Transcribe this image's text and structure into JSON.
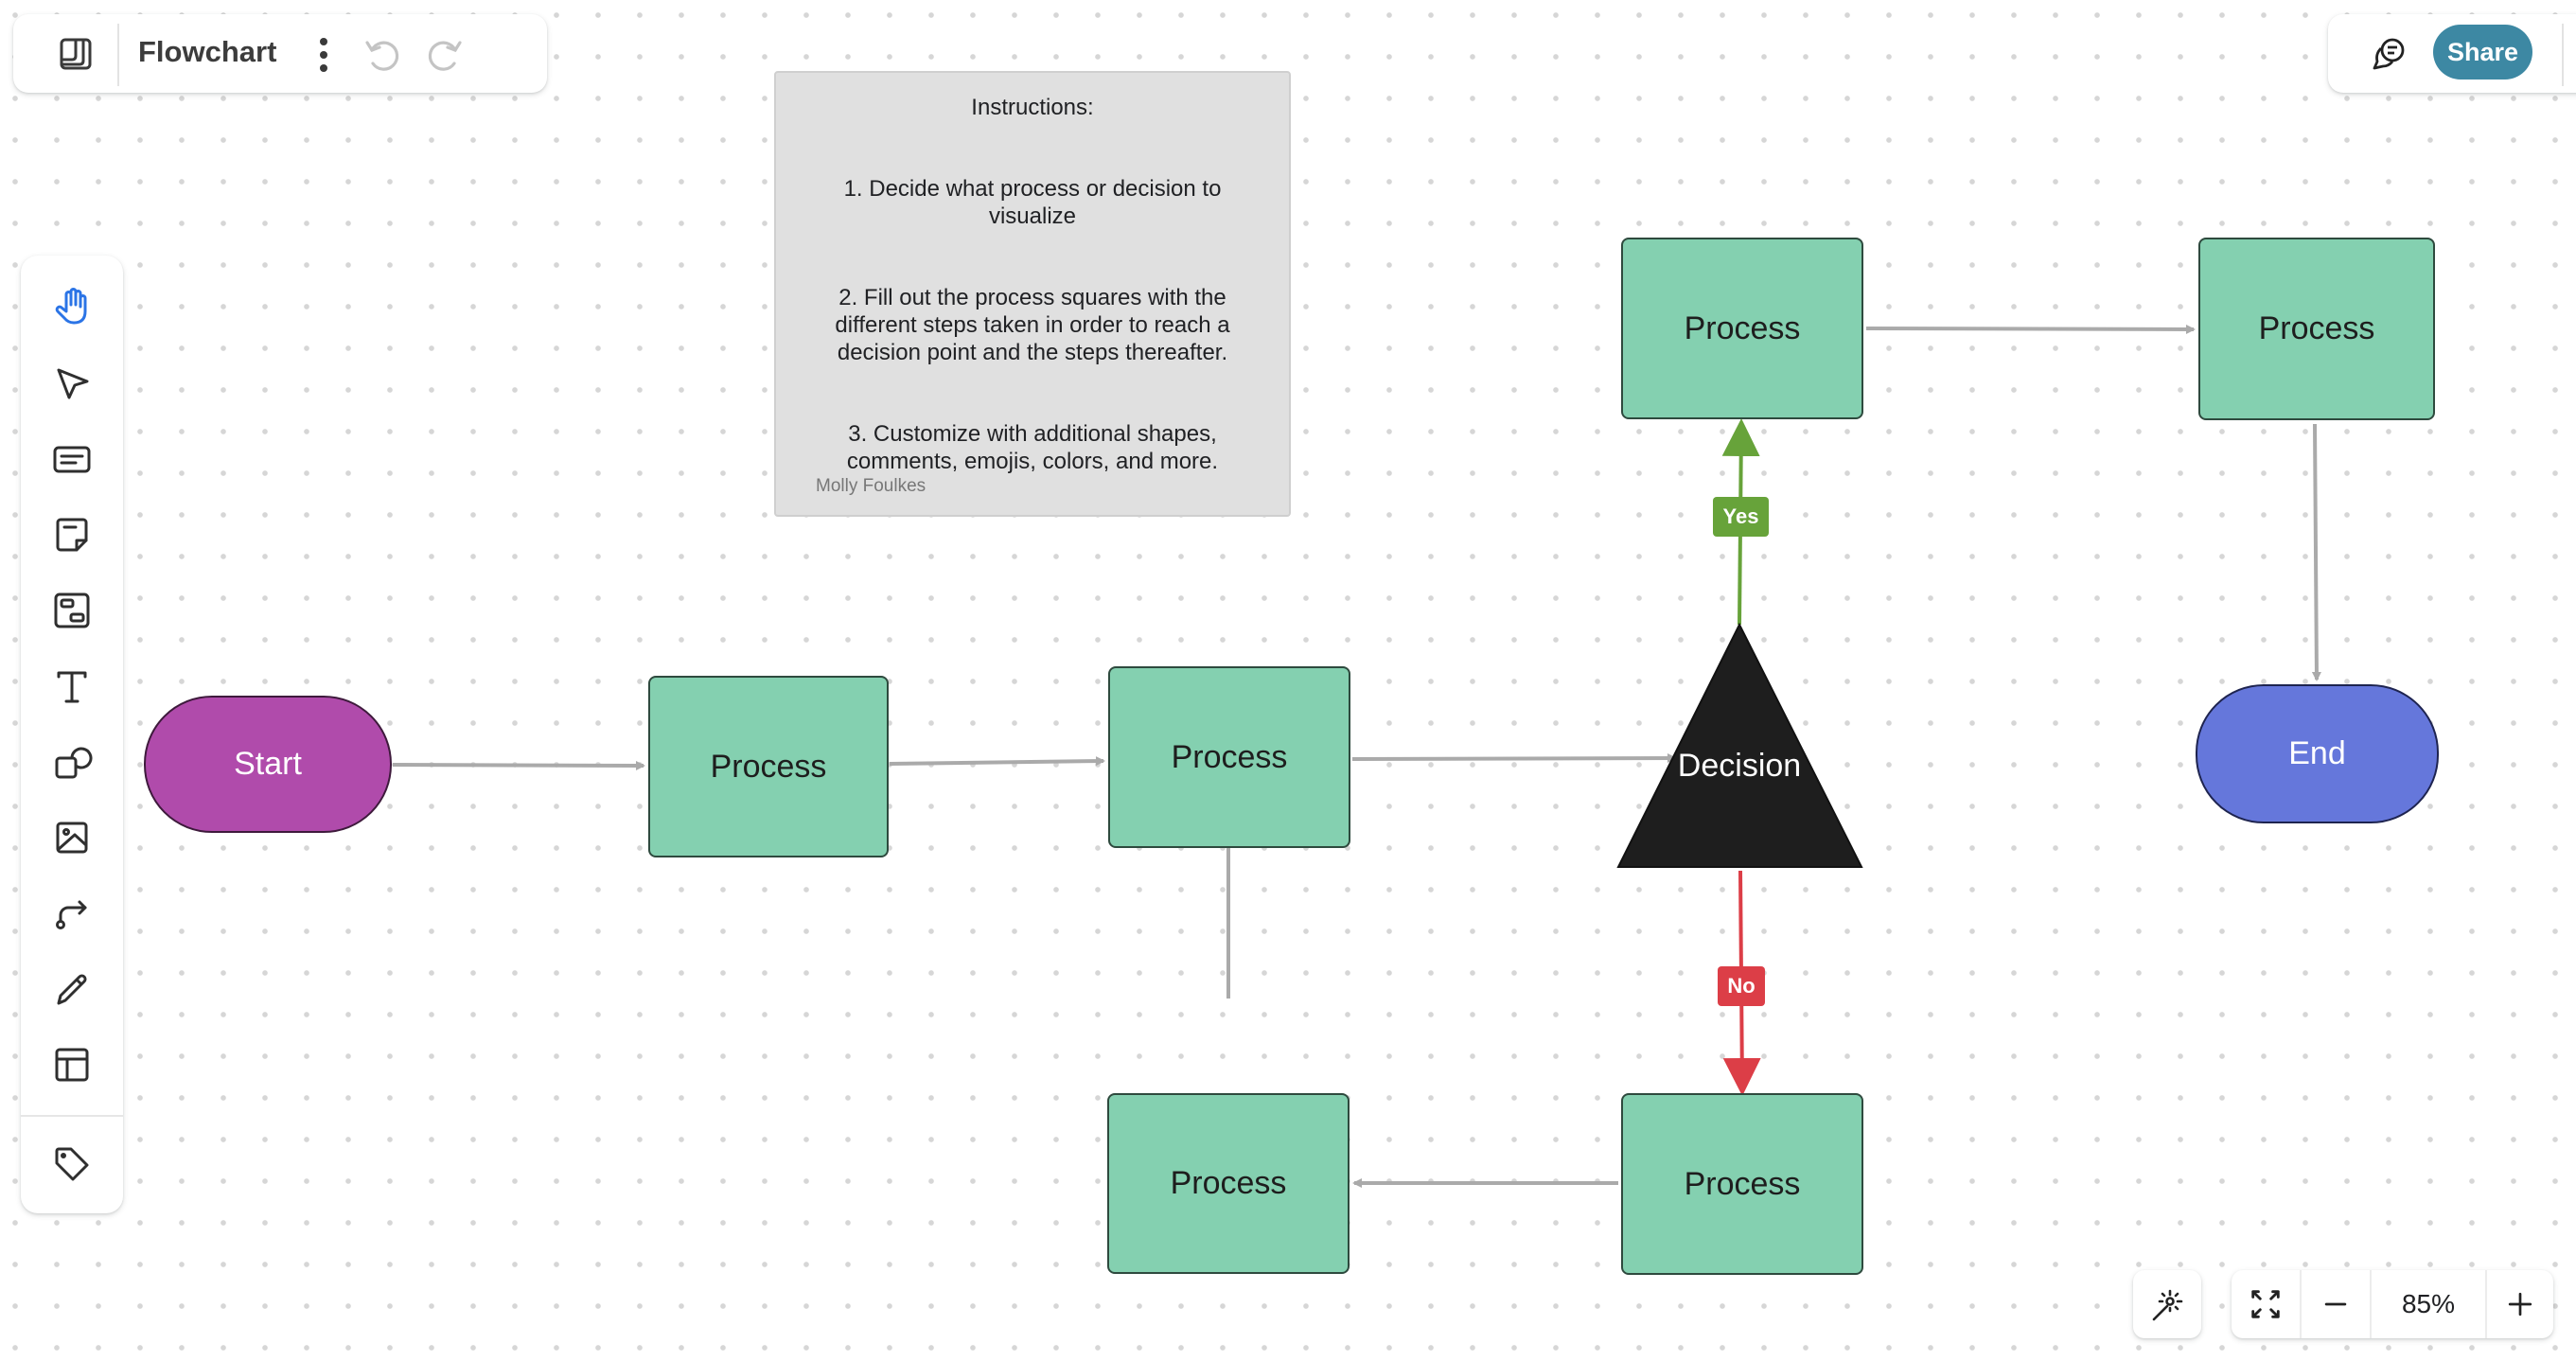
{
  "header": {
    "board_icon": "board-icon",
    "title": "Flowchart",
    "more_icon": "more-vertical-icon",
    "undo_icon": "undo-icon",
    "redo_icon": "redo-icon"
  },
  "header_right": {
    "comment_icon": "comment-icon",
    "share_label": "Share",
    "share_color": "#3d88a3"
  },
  "toolbar": {
    "items": [
      {
        "name": "hand",
        "icon": "hand-icon",
        "active": true
      },
      {
        "name": "select",
        "icon": "cursor-icon"
      },
      {
        "name": "text-box",
        "icon": "text-box-icon"
      },
      {
        "name": "sticky-note",
        "icon": "sticky-note-icon"
      },
      {
        "name": "frame",
        "icon": "frame-icon"
      },
      {
        "name": "text",
        "icon": "text-icon"
      },
      {
        "name": "shapes",
        "icon": "shapes-icon"
      },
      {
        "name": "image",
        "icon": "image-icon"
      },
      {
        "name": "connector",
        "icon": "connector-icon"
      },
      {
        "name": "pen",
        "icon": "pen-icon"
      },
      {
        "name": "template",
        "icon": "template-icon"
      },
      {
        "name": "tag",
        "icon": "tag-icon"
      }
    ],
    "active_color": "#2b74e6"
  },
  "instructions": {
    "heading": "Instructions:",
    "step1": "1. Decide what process or decision to visualize",
    "step2": "2. Fill out the process squares with the different steps taken in order to reach a decision point and the steps thereafter.",
    "step3": "3. Customize with additional shapes, comments, emojis, colors, and more.",
    "author": "Molly Foulkes"
  },
  "flowchart": {
    "start": {
      "label": "Start",
      "color": "#b04bab"
    },
    "end": {
      "label": "End",
      "color": "#6577db"
    },
    "process_color": "#84d0b0",
    "processes": [
      {
        "id": "p1",
        "label": "Process"
      },
      {
        "id": "p2",
        "label": "Process"
      },
      {
        "id": "p3",
        "label": "Process"
      },
      {
        "id": "p4",
        "label": "Process"
      },
      {
        "id": "p5",
        "label": "Process"
      },
      {
        "id": "p6",
        "label": "Process"
      }
    ],
    "decision": {
      "label": "Decision",
      "color": "#1e1e1e"
    },
    "edges": [
      {
        "from": "start",
        "to": "p1"
      },
      {
        "from": "p1",
        "to": "p2"
      },
      {
        "from": "p2",
        "to": "decision"
      },
      {
        "from": "decision",
        "to": "p3",
        "label": "Yes",
        "color": "#67a33a"
      },
      {
        "from": "p3",
        "to": "p4"
      },
      {
        "from": "p4",
        "to": "end"
      },
      {
        "from": "decision",
        "to": "p5",
        "label": "No",
        "color": "#dc3e47"
      },
      {
        "from": "p5",
        "to": "p6"
      },
      {
        "from": "p6",
        "to": "p2"
      }
    ],
    "yes_label": "Yes",
    "no_label": "No"
  },
  "zoom_controls": {
    "magic_icon": "magic-wand-icon",
    "fit_icon": "fit-screen-icon",
    "zoom_out_icon": "minus-icon",
    "zoom_level": "85%",
    "zoom_in_icon": "plus-icon"
  }
}
